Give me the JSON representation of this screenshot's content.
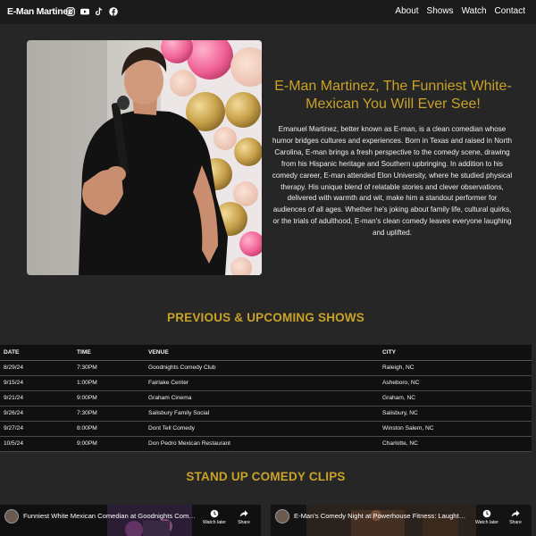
{
  "nav": {
    "brand": "E-Man Martinez",
    "socials": [
      "instagram-icon",
      "youtube-icon",
      "tiktok-icon",
      "facebook-icon"
    ],
    "links": [
      "About",
      "Shows",
      "Watch",
      "Contact"
    ]
  },
  "hero": {
    "title": "E-Man Martinez, The Funniest White-Mexican You Will Ever See!",
    "bio": "Emanuel Martinez, better known as E-man, is a clean comedian whose humor bridges cultures and experiences. Born in Texas and raised in North Carolina, E-man brings a fresh perspective to the comedy scene, drawing from his Hispanic heritage and Southern upbringing. In addition to his comedy career, E-man attended Elon University, where he studied physical therapy. His unique blend of relatable stories and clever observations, delivered with warmth and wit, make him a standout performer for audiences of all ages. Whether he's joking about family life, cultural quirks, or the trials of adulthood, E-man's clean comedy leaves everyone laughing and uplifted."
  },
  "shows": {
    "title": "PREVIOUS & UPCOMING SHOWS",
    "headers": [
      "DATE",
      "TIME",
      "VENUE",
      "CITY"
    ],
    "rows": [
      [
        "8/29/24",
        "7:30PM",
        "Goodnights Comedy Club",
        "Raleigh, NC"
      ],
      [
        "9/15/24",
        "1:00PM",
        "Fairlake Center",
        "Asheboro, NC"
      ],
      [
        "9/21/24",
        "9:00PM",
        "Graham Cinema",
        "Graham, NC"
      ],
      [
        "9/26/24",
        "7:30PM",
        "Salisbury Family Social",
        "Salisbury, NC"
      ],
      [
        "9/27/24",
        "8:00PM",
        "Dont Tell Comedy",
        "Winston Salem, NC"
      ],
      [
        "10/5/24",
        "9:00PM",
        "Don Pedro Mexican Restaurant",
        "Charlotte, NC"
      ]
    ]
  },
  "clips": {
    "title": "STAND UP COMEDY CLIPS",
    "items": [
      {
        "title": "Funniest White Mexican Comedian at Goodnights Comed...",
        "watch_later": "Watch later",
        "share": "Share"
      },
      {
        "title": "E-Man's Comedy Night at Powerhouse Fitness: Laughter a...",
        "watch_later": "Watch later",
        "share": "Share"
      }
    ]
  }
}
